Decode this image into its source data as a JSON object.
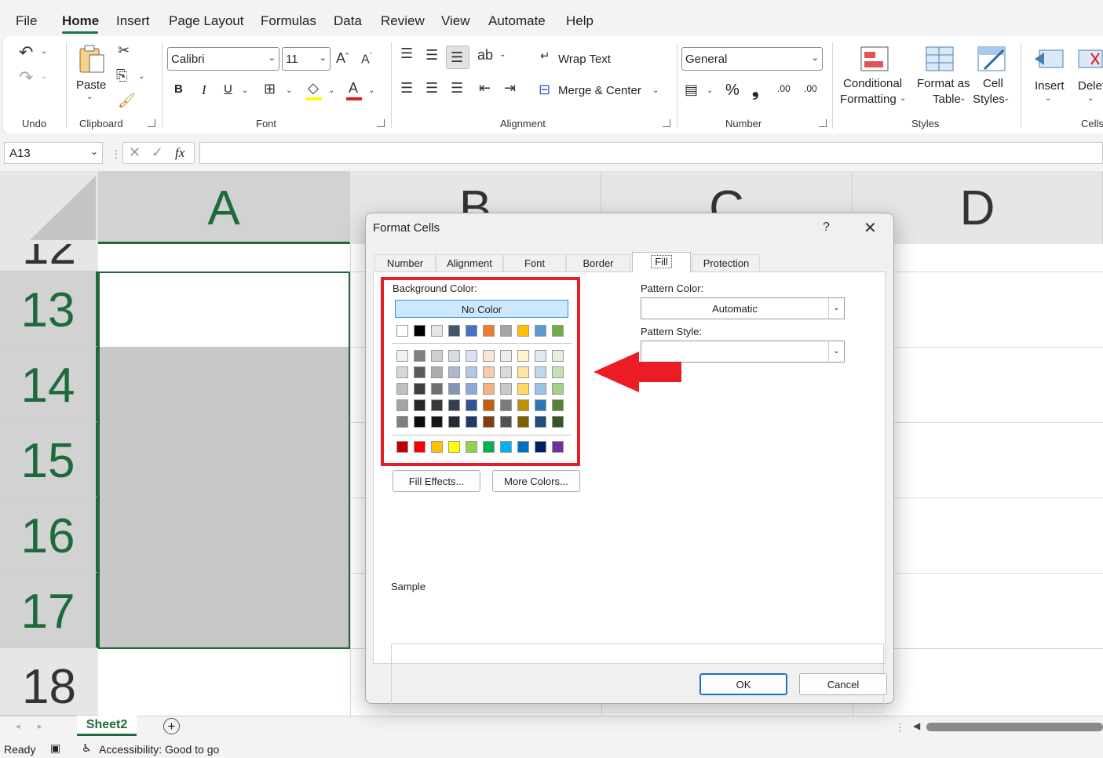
{
  "menu": {
    "items": [
      "File",
      "Home",
      "Insert",
      "Page Layout",
      "Formulas",
      "Data",
      "Review",
      "View",
      "Automate",
      "Help"
    ]
  },
  "ribbon": {
    "groups": {
      "undo": "Undo",
      "clipboard": "Clipboard",
      "font": "Font",
      "alignment": "Alignment",
      "number": "Number",
      "styles": "Styles",
      "cells": "Cells"
    },
    "paste_label": "Paste",
    "font_name": "Calibri",
    "font_size": "11",
    "bold": "B",
    "italic": "I",
    "underline": "U",
    "wrap_text": "Wrap Text",
    "merge_center": "Merge & Center",
    "number_format": "General",
    "percent": "%",
    "comma": "❟",
    "inc_decimal": ".00",
    "dec_decimal": ".00",
    "conditional_formatting_1": "Conditional",
    "conditional_formatting_2": "Formatting",
    "format_table_1": "Format as",
    "format_table_2": "Table",
    "cell_styles_1": "Cell",
    "cell_styles_2": "Styles",
    "insert": "Insert",
    "delete": "Delet"
  },
  "formula_bar": {
    "name_box": "A13",
    "fx": "fx",
    "formula": ""
  },
  "grid": {
    "columns": [
      "A",
      "B",
      "C",
      "D"
    ],
    "rows": [
      "12",
      "13",
      "14",
      "15",
      "16",
      "17",
      "18"
    ]
  },
  "sheet_tab": "Sheet2",
  "status": {
    "ready": "Ready",
    "accessibility": "Accessibility: Good to go"
  },
  "dialog": {
    "title": "Format Cells",
    "help": "?",
    "close": "✕",
    "tabs": [
      "Number",
      "Alignment",
      "Font",
      "Border",
      "Fill",
      "Protection"
    ],
    "active_tab": "Fill",
    "background_color_label": "Background Color:",
    "no_color": "No Color",
    "pattern_color_label": "Pattern Color:",
    "pattern_color_value": "Automatic",
    "pattern_style_label": "Pattern Style:",
    "pattern_style_value": "",
    "fill_effects": "Fill Effects...",
    "more_colors": "More Colors...",
    "sample_label": "Sample",
    "ok": "OK",
    "cancel": "Cancel",
    "palette_top": [
      "#ffffff",
      "#000000",
      "#e7e6e6",
      "#44546a",
      "#4472c4",
      "#ed7d31",
      "#a5a5a5",
      "#ffc000",
      "#5b9bd5",
      "#70ad47"
    ],
    "palette_shades": [
      [
        "#f2f2f2",
        "#7f7f7f",
        "#d0cece",
        "#d6dce4",
        "#d9e2f3",
        "#fbe5d5",
        "#ededed",
        "#fff2cc",
        "#deeaf6",
        "#e2efd9"
      ],
      [
        "#d8d8d8",
        "#595959",
        "#aeabab",
        "#adb9ca",
        "#b4c6e7",
        "#f7cbac",
        "#dbdbdb",
        "#fee599",
        "#bdd7ee",
        "#c5e0b3"
      ],
      [
        "#bfbfbf",
        "#3f3f3f",
        "#757070",
        "#8496b0",
        "#8eaadb",
        "#f4b183",
        "#c9c9c9",
        "#ffd965",
        "#9cc3e5",
        "#a8d08d"
      ],
      [
        "#a5a5a5",
        "#262626",
        "#3a3838",
        "#323f4f",
        "#2f5496",
        "#c55a11",
        "#7b7b7b",
        "#bf9000",
        "#2e75b5",
        "#538135"
      ],
      [
        "#7f7f7f",
        "#0c0c0c",
        "#161616",
        "#222a35",
        "#1f3864",
        "#833c0b",
        "#525252",
        "#7f6000",
        "#1e4e79",
        "#375623"
      ]
    ],
    "palette_standard": [
      "#c00000",
      "#ff0000",
      "#ffc000",
      "#ffff00",
      "#92d050",
      "#00b050",
      "#00b0f0",
      "#0070c0",
      "#002060",
      "#7030a0"
    ]
  },
  "annotation": {
    "highlight_color": "#e0202a"
  }
}
